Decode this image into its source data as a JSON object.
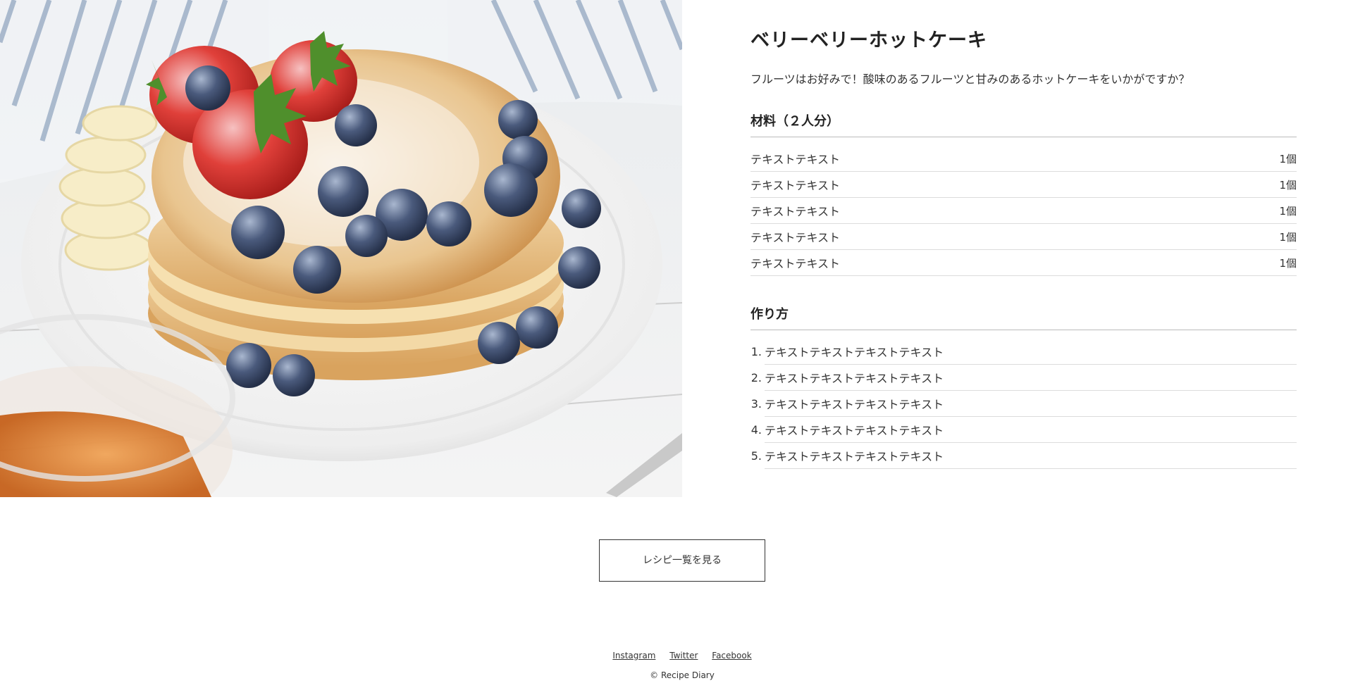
{
  "recipe": {
    "title": "ベリーベリーホットケーキ",
    "description": "フルーツはお好みで！酸味のあるフルーツと甘みのあるホットケーキをいかがですか？",
    "ingredients_heading": "材料（２人分）",
    "ingredients": [
      {
        "name": "テキストテキスト",
        "qty": "1個"
      },
      {
        "name": "テキストテキスト",
        "qty": "1個"
      },
      {
        "name": "テキストテキスト",
        "qty": "1個"
      },
      {
        "name": "テキストテキスト",
        "qty": "1個"
      },
      {
        "name": "テキストテキスト",
        "qty": "1個"
      }
    ],
    "steps_heading": "作り方",
    "steps": [
      {
        "num": "1.",
        "text": "テキストテキストテキストテキスト"
      },
      {
        "num": "2.",
        "text": "テキストテキストテキストテキスト"
      },
      {
        "num": "3.",
        "text": "テキストテキストテキストテキスト"
      },
      {
        "num": "4.",
        "text": "テキストテキストテキストテキスト"
      },
      {
        "num": "5.",
        "text": "テキストテキストテキストテキスト"
      }
    ]
  },
  "hero_image": {
    "subject": "pancakes-with-berries-photo"
  },
  "actions": {
    "list_button_label": "レシピ一覧を見る"
  },
  "footer": {
    "links": [
      "Instagram",
      "Twitter",
      "Facebook"
    ],
    "copyright": "© Recipe Diary"
  },
  "colors": {
    "text": "#333333",
    "divider": "#dcdcdc",
    "button_border": "#333333"
  }
}
